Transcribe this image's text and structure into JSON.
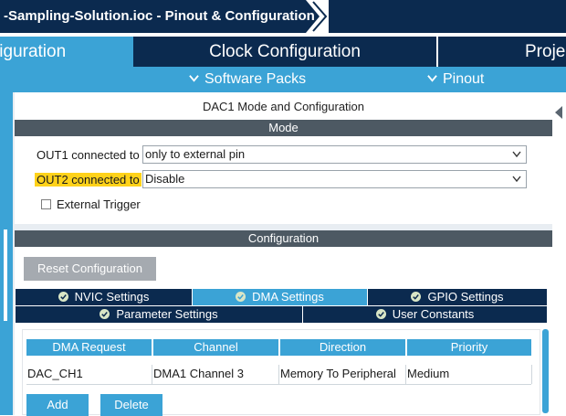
{
  "breadcrumb": {
    "file_label": "-Sampling-Solution.ioc - Pinout & Configuration"
  },
  "main_tabs": [
    {
      "label": "figuration",
      "active": true
    },
    {
      "label": "Clock Configuration",
      "active": false
    },
    {
      "label": "Proje",
      "active": false
    }
  ],
  "sub_tabs": [
    {
      "label": "Software Packs",
      "icon": "chevron-down-icon"
    },
    {
      "label": "Pinout",
      "icon": "chevron-down-icon"
    }
  ],
  "dac_panel": {
    "title": "DAC1 Mode and Configuration",
    "mode_header": "Mode",
    "out1": {
      "label": "OUT1 connected to",
      "value": "only to external pin"
    },
    "out2": {
      "label": "OUT2 connected to",
      "value": "Disable"
    },
    "external_trigger": {
      "label": "External Trigger",
      "checked": false
    }
  },
  "configuration": {
    "header": "Configuration",
    "reset_button": "Reset Configuration",
    "tabs_row1": [
      {
        "label": "NVIC Settings",
        "active": false
      },
      {
        "label": "DMA Settings",
        "active": true
      },
      {
        "label": "GPIO Settings",
        "active": false
      }
    ],
    "tabs_row2": [
      {
        "label": "Parameter Settings",
        "active": false
      },
      {
        "label": "User Constants",
        "active": false
      }
    ],
    "table": {
      "columns": [
        "DMA Request",
        "Channel",
        "Direction",
        "Priority"
      ],
      "rows": [
        [
          "DAC_CH1",
          "DMA1 Channel 3",
          "Memory To Peripheral",
          "Medium"
        ]
      ]
    },
    "add_button": "Add",
    "delete_button": "Delete"
  },
  "colors": {
    "navy": "#0b2a4f",
    "accent_blue": "#3ba3d6",
    "section_bar": "#4d5963",
    "highlight": "#ffd21a",
    "disabled_button": "#a5aab0"
  }
}
